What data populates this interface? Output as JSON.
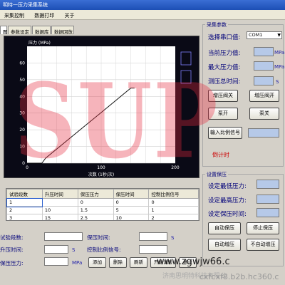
{
  "window": {
    "title": "明特一压力采集系统"
  },
  "menu": [
    "采集控制",
    "数据打印",
    "关于"
  ],
  "tabs": [
    {
      "label": "图"
    },
    {
      "label": "参数设定"
    },
    {
      "label": "数据库"
    },
    {
      "label": "数据回放"
    }
  ],
  "chart_data": {
    "type": "line",
    "ylabel": "压力 (MPa)",
    "xlabel": "次数 (1秒/次)",
    "xlim": [
      0,
      200
    ],
    "ylim": [
      0,
      70
    ],
    "xticks": [
      0,
      100,
      200
    ],
    "yticks": [
      0,
      10,
      20,
      30,
      40,
      50,
      60
    ],
    "grid": true,
    "colors": {
      "background": "#0a0a16",
      "plot": "#ffffff",
      "line": "#111111",
      "axis_text": "#ffffff"
    },
    "series": [
      {
        "x": [
          0,
          20,
          25,
          110,
          140,
          145
        ],
        "y": [
          0,
          0,
          3,
          34,
          45,
          45
        ]
      }
    ]
  },
  "table": {
    "headers": [
      "试验段数",
      "升压时间",
      "保压压力",
      "保压时间",
      "控制比例信号"
    ],
    "rows": [
      [
        "1",
        "",
        "0",
        "0",
        "0"
      ],
      [
        "2",
        "10",
        "1.5",
        "5",
        "1"
      ],
      [
        "3",
        "15",
        "2.5",
        "10",
        "2"
      ]
    ]
  },
  "left_form": {
    "segments_label": "试验段数:",
    "boost_time_label": "升压时间:",
    "hold_pressure_label": "保压压力:",
    "hold_time_label": "保压时间:",
    "control_signal_label": "控制比例信号:",
    "unit_s": "S",
    "unit_mpa": "MPa"
  },
  "buttons": {
    "add": "添加",
    "delete": "删除",
    "refresh": "刷新",
    "start_test": "开始试验",
    "stop": "停止"
  },
  "right_panel": {
    "group_title": "采集参数",
    "port_label": "选择串口值:",
    "port_value": "COM1",
    "current_pressure_label": "当前压力值:",
    "max_pressure_label": "最大压力值:",
    "total_time_label": "测压总时间:",
    "unit_mpa": "MPa",
    "unit_s": "S",
    "btn_boost_valve_close": "增压阀关",
    "btn_boost_valve_open": "增压阀开",
    "btn_pump_on": "泵开",
    "btn_pump_off": "泵关",
    "btn_input_signal": "输入比例信号",
    "countdown_label": "倒计时",
    "group2_title": "设置保压",
    "set_min_pressure_label": "设定最低压力:",
    "set_max_pressure_label": "设定最高压力:",
    "set_hold_pressure_label": "设定保压时间:",
    "btn_auto_hold": "自动保压",
    "btn_stop_hold": "停止保压",
    "btn_auto_boost": "自动增压",
    "btn_no_auto_boost": "不自动增压"
  },
  "watermark": {
    "text": "SUP"
  },
  "footer": {
    "site": "www.zgwjw66.c",
    "company": "济南思明特科技有限公",
    "url": "cxfcxf8.b2b.hc360.c"
  }
}
